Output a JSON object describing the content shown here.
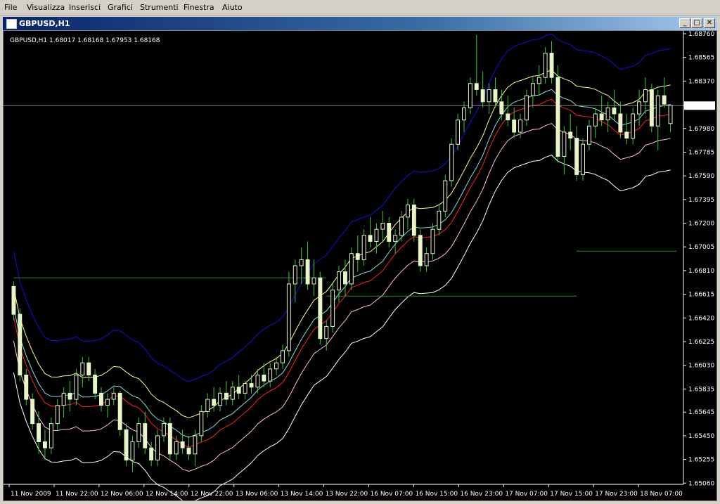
{
  "menu": {
    "items": [
      "File",
      "Visualizza",
      "Inserisci",
      "Grafici",
      "Strumenti",
      "Finestra",
      "Aiuto"
    ]
  },
  "window": {
    "title": "GBPUSD,H1",
    "minimize_glyph": "_",
    "restore_glyph": "□",
    "close_glyph": "✕"
  },
  "chart_info": {
    "header": "GBPUSD,H1  1.68017 1.68168 1.67953 1.68168"
  },
  "colors": {
    "background": "#000000",
    "axis": "#ffffff",
    "candle": "#e8f5c8",
    "wick": "#32cd32",
    "band_outer_top": "#1010e0",
    "band_yellow": "#ffff80",
    "band_cyan": "#80e0e0",
    "band_red": "#ff2020",
    "band_pink": "#ffc0d0",
    "band_outer_bottom": "#ffffff",
    "step_line": "#2e8b2e",
    "price_line": "#808080"
  },
  "chart_data": {
    "type": "candlestick",
    "symbol": "GBPUSD",
    "timeframe": "H1",
    "ylim": [
      1.6505,
      1.6876
    ],
    "y_ticks": [
      "1.68760",
      "1.68565",
      "1.68370",
      "1.68168",
      "1.67980",
      "1.67785",
      "1.67590",
      "1.67395",
      "1.67200",
      "1.67005",
      "1.66810",
      "1.66615",
      "1.66420",
      "1.66225",
      "1.66030",
      "1.65835",
      "1.65645",
      "1.65450",
      "1.65255",
      "1.65060"
    ],
    "current_price": "1.68168",
    "x_ticks": [
      "11 Nov 2009",
      "11 Nov 22:00",
      "12 Nov 06:00",
      "12 Nov 14:00",
      "12 Nov 22:00",
      "13 Nov 06:00",
      "13 Nov 14:00",
      "13 Nov 22:00",
      "16 Nov 07:00",
      "16 Nov 15:00",
      "16 Nov 23:00",
      "17 Nov 07:00",
      "17 Nov 15:00",
      "17 Nov 23:00",
      "18 Nov 07:00"
    ],
    "candles_ohlc": [
      [
        1.6668,
        1.6672,
        1.664,
        1.6645
      ],
      [
        1.6645,
        1.665,
        1.659,
        1.6595
      ],
      [
        1.6595,
        1.66,
        1.657,
        1.6575
      ],
      [
        1.6575,
        1.658,
        1.655,
        1.6555
      ],
      [
        1.6555,
        1.6565,
        1.653,
        1.654
      ],
      [
        1.654,
        1.655,
        1.6525,
        1.6535
      ],
      [
        1.6535,
        1.656,
        1.653,
        1.6555
      ],
      [
        1.6555,
        1.6575,
        1.655,
        1.657
      ],
      [
        1.657,
        1.6585,
        1.656,
        1.658
      ],
      [
        1.658,
        1.659,
        1.6565,
        1.6575
      ],
      [
        1.6575,
        1.66,
        1.657,
        1.6595
      ],
      [
        1.6595,
        1.661,
        1.6585,
        1.6605
      ],
      [
        1.6605,
        1.661,
        1.659,
        1.6595
      ],
      [
        1.6595,
        1.66,
        1.6575,
        1.658
      ],
      [
        1.658,
        1.6585,
        1.6565,
        1.657
      ],
      [
        1.657,
        1.658,
        1.656,
        1.6575
      ],
      [
        1.6575,
        1.6585,
        1.657,
        1.658
      ],
      [
        1.658,
        1.6582,
        1.6545,
        1.655
      ],
      [
        1.655,
        1.6555,
        1.652,
        1.6525
      ],
      [
        1.6525,
        1.6545,
        1.6515,
        1.654
      ],
      [
        1.654,
        1.656,
        1.6535,
        1.6555
      ],
      [
        1.6555,
        1.6565,
        1.653,
        1.6535
      ],
      [
        1.6535,
        1.654,
        1.652,
        1.6525
      ],
      [
        1.6525,
        1.655,
        1.652,
        1.6545
      ],
      [
        1.6545,
        1.656,
        1.654,
        1.6555
      ],
      [
        1.6555,
        1.656,
        1.6525,
        1.653
      ],
      [
        1.653,
        1.6545,
        1.6525,
        1.654
      ],
      [
        1.654,
        1.655,
        1.653,
        1.6535
      ],
      [
        1.6535,
        1.6545,
        1.6525,
        1.653
      ],
      [
        1.653,
        1.655,
        1.652,
        1.6545
      ],
      [
        1.6545,
        1.657,
        1.654,
        1.6565
      ],
      [
        1.6565,
        1.658,
        1.656,
        1.6575
      ],
      [
        1.6575,
        1.6585,
        1.6565,
        1.657
      ],
      [
        1.657,
        1.6585,
        1.6565,
        1.658
      ],
      [
        1.658,
        1.659,
        1.657,
        1.6575
      ],
      [
        1.6575,
        1.659,
        1.657,
        1.6585
      ],
      [
        1.6585,
        1.6595,
        1.6575,
        1.658
      ],
      [
        1.658,
        1.659,
        1.6575,
        1.6588
      ],
      [
        1.6588,
        1.6595,
        1.658,
        1.6585
      ],
      [
        1.6585,
        1.66,
        1.658,
        1.6595
      ],
      [
        1.6595,
        1.6605,
        1.6585,
        1.659
      ],
      [
        1.659,
        1.6605,
        1.6585,
        1.66
      ],
      [
        1.66,
        1.661,
        1.6595,
        1.6605
      ],
      [
        1.6605,
        1.662,
        1.66,
        1.6615
      ],
      [
        1.6615,
        1.668,
        1.661,
        1.667
      ],
      [
        1.667,
        1.669,
        1.6655,
        1.6685
      ],
      [
        1.6685,
        1.67,
        1.667,
        1.669
      ],
      [
        1.669,
        1.6705,
        1.6665,
        1.667
      ],
      [
        1.667,
        1.669,
        1.666,
        1.6675
      ],
      [
        1.6675,
        1.668,
        1.662,
        1.6625
      ],
      [
        1.6625,
        1.664,
        1.6615,
        1.6635
      ],
      [
        1.6635,
        1.667,
        1.663,
        1.6665
      ],
      [
        1.6665,
        1.6685,
        1.6655,
        1.668
      ],
      [
        1.668,
        1.669,
        1.666,
        1.667
      ],
      [
        1.667,
        1.67,
        1.6665,
        1.6695
      ],
      [
        1.6695,
        1.671,
        1.668,
        1.669
      ],
      [
        1.669,
        1.6715,
        1.6685,
        1.671
      ],
      [
        1.671,
        1.6725,
        1.67,
        1.6705
      ],
      [
        1.6705,
        1.672,
        1.6695,
        1.6715
      ],
      [
        1.6715,
        1.673,
        1.6705,
        1.672
      ],
      [
        1.672,
        1.6725,
        1.67,
        1.6705
      ],
      [
        1.6705,
        1.6715,
        1.6695,
        1.671
      ],
      [
        1.671,
        1.673,
        1.6705,
        1.6725
      ],
      [
        1.6725,
        1.674,
        1.6715,
        1.6735
      ],
      [
        1.6735,
        1.674,
        1.6705,
        1.671
      ],
      [
        1.671,
        1.6715,
        1.668,
        1.6685
      ],
      [
        1.6685,
        1.67,
        1.668,
        1.6695
      ],
      [
        1.6695,
        1.672,
        1.669,
        1.6715
      ],
      [
        1.6715,
        1.6735,
        1.671,
        1.673
      ],
      [
        1.673,
        1.676,
        1.6725,
        1.6755
      ],
      [
        1.6755,
        1.679,
        1.675,
        1.6785
      ],
      [
        1.6785,
        1.681,
        1.678,
        1.6805
      ],
      [
        1.6805,
        1.682,
        1.6795,
        1.6815
      ],
      [
        1.6815,
        1.684,
        1.681,
        1.6835
      ],
      [
        1.6835,
        1.6875,
        1.6825,
        1.683
      ],
      [
        1.683,
        1.6845,
        1.6815,
        1.682
      ],
      [
        1.682,
        1.6835,
        1.681,
        1.683
      ],
      [
        1.683,
        1.684,
        1.6815,
        1.682
      ],
      [
        1.682,
        1.683,
        1.6805,
        1.681
      ],
      [
        1.681,
        1.6825,
        1.68,
        1.6805
      ],
      [
        1.6805,
        1.6815,
        1.679,
        1.6795
      ],
      [
        1.6795,
        1.681,
        1.679,
        1.6805
      ],
      [
        1.6805,
        1.683,
        1.68,
        1.6825
      ],
      [
        1.6825,
        1.684,
        1.6815,
        1.6835
      ],
      [
        1.6835,
        1.685,
        1.6825,
        1.684
      ],
      [
        1.684,
        1.6865,
        1.6835,
        1.686
      ],
      [
        1.686,
        1.687,
        1.6835,
        1.684
      ],
      [
        1.684,
        1.685,
        1.677,
        1.6775
      ],
      [
        1.6775,
        1.68,
        1.676,
        1.6795
      ],
      [
        1.6795,
        1.681,
        1.678,
        1.679
      ],
      [
        1.679,
        1.68,
        1.6755,
        1.676
      ],
      [
        1.676,
        1.679,
        1.6755,
        1.6785
      ],
      [
        1.6785,
        1.6805,
        1.678,
        1.68
      ],
      [
        1.68,
        1.6815,
        1.679,
        1.681
      ],
      [
        1.681,
        1.6825,
        1.68,
        1.6805
      ],
      [
        1.6805,
        1.682,
        1.6795,
        1.6815
      ],
      [
        1.6815,
        1.683,
        1.6805,
        1.681
      ],
      [
        1.681,
        1.682,
        1.679,
        1.6795
      ],
      [
        1.6795,
        1.681,
        1.6785,
        1.679
      ],
      [
        1.679,
        1.6815,
        1.6785,
        1.681
      ],
      [
        1.681,
        1.683,
        1.68,
        1.682
      ],
      [
        1.682,
        1.684,
        1.681,
        1.683
      ],
      [
        1.683,
        1.6835,
        1.6795,
        1.68
      ],
      [
        1.68,
        1.683,
        1.678,
        1.6825
      ],
      [
        1.6825,
        1.684,
        1.6815,
        1.6818
      ],
      [
        1.6802,
        1.6817,
        1.6795,
        1.6817
      ]
    ],
    "step_line_levels": [
      1.6675,
      1.666,
      1.6697
    ],
    "legend": "none",
    "grid": false
  }
}
